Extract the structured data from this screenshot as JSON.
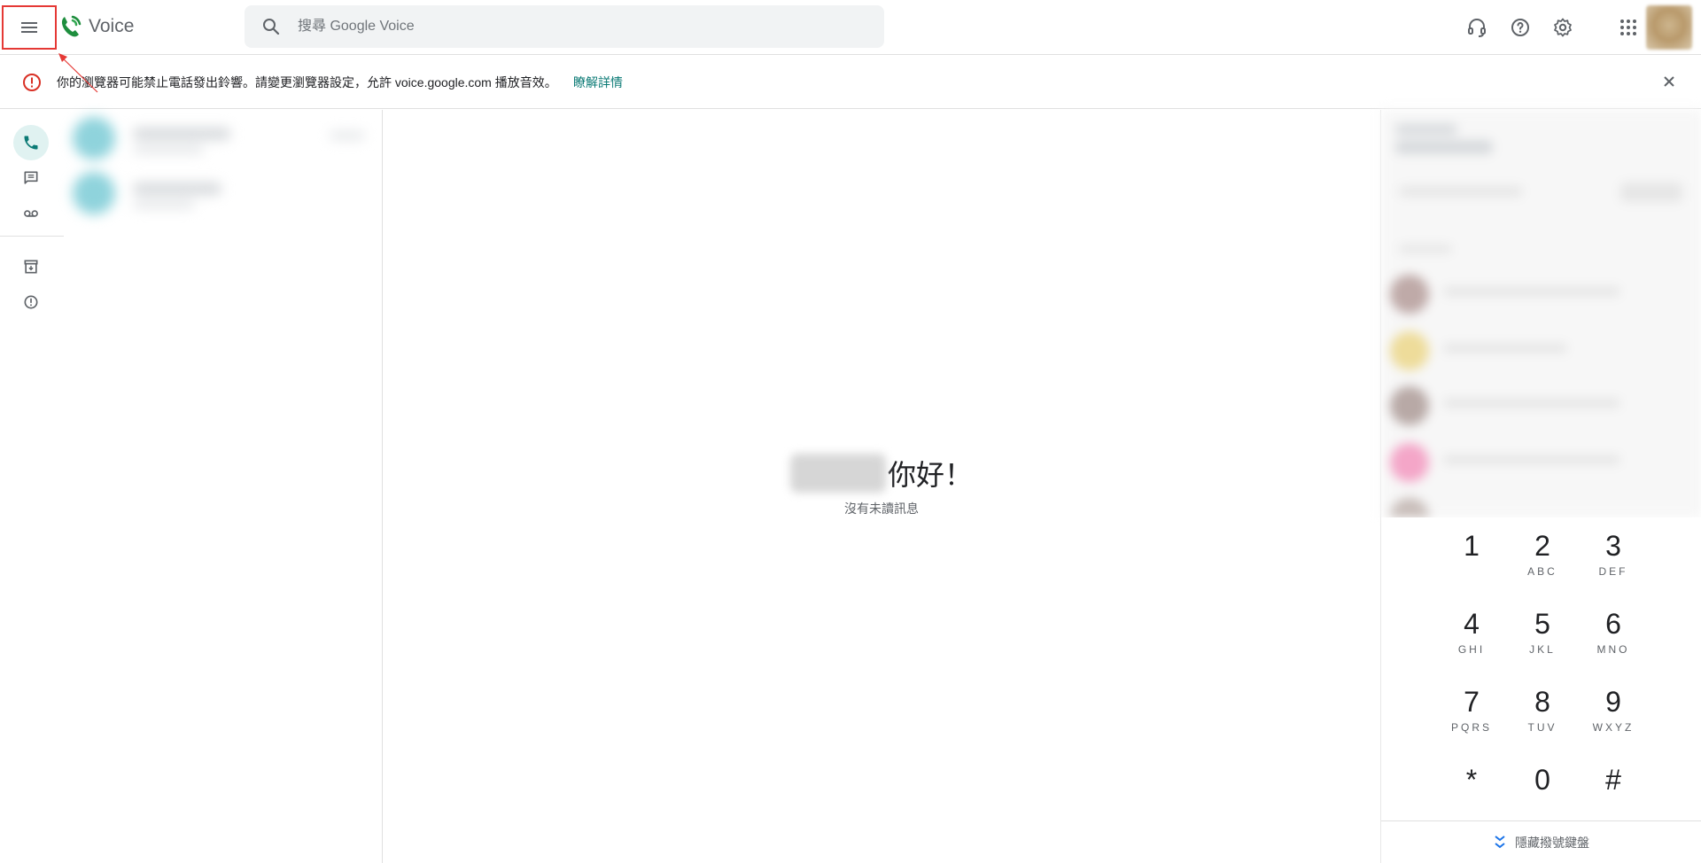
{
  "header": {
    "app_name": "Voice",
    "search_placeholder": "搜尋 Google Voice",
    "icons": [
      "menu-icon",
      "search-icon",
      "headset-icon",
      "help-icon",
      "settings-icon",
      "apps-icon"
    ]
  },
  "banner": {
    "message": "你的瀏覽器可能禁止電話發出鈴響。請變更瀏覽器設定，允許 voice.google.com 播放音效。",
    "link": "瞭解詳情"
  },
  "rail": {
    "items": [
      "phone-icon",
      "messages-icon",
      "voicemail-icon",
      "archive-icon",
      "spam-icon"
    ]
  },
  "center": {
    "greeting": "你好！",
    "subtitle": "沒有未讀訊息"
  },
  "dialpad": {
    "keys": [
      {
        "digit": "1",
        "letters": ""
      },
      {
        "digit": "2",
        "letters": "ABC"
      },
      {
        "digit": "3",
        "letters": "DEF"
      },
      {
        "digit": "4",
        "letters": "GHI"
      },
      {
        "digit": "5",
        "letters": "JKL"
      },
      {
        "digit": "6",
        "letters": "MNO"
      },
      {
        "digit": "7",
        "letters": "PQRS"
      },
      {
        "digit": "8",
        "letters": "TUV"
      },
      {
        "digit": "9",
        "letters": "WXYZ"
      },
      {
        "digit": "*",
        "letters": ""
      },
      {
        "digit": "0",
        "letters": ""
      },
      {
        "digit": "#",
        "letters": ""
      }
    ],
    "hide_label": "隱藏撥號鍵盤"
  },
  "colors": {
    "accent": "#0b7a75",
    "warning": "#d93025",
    "highlight_box": "#e53935"
  }
}
